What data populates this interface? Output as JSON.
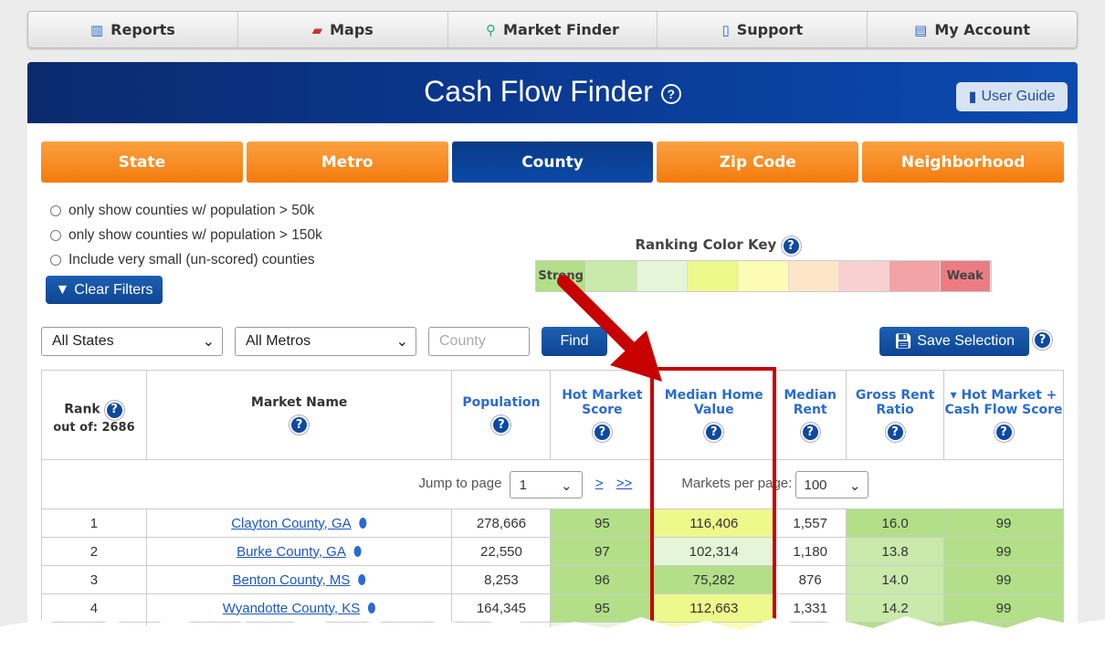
{
  "nav": [
    {
      "label": "Reports",
      "icon": "reports-icon"
    },
    {
      "label": "Maps",
      "icon": "map-icon"
    },
    {
      "label": "Market Finder",
      "icon": "market-finder-icon"
    },
    {
      "label": "Support",
      "icon": "phone-icon"
    },
    {
      "label": "My Account",
      "icon": "account-icon"
    }
  ],
  "banner": {
    "title": "Cash Flow Finder",
    "user_guide": "User Guide"
  },
  "tabs": [
    {
      "label": "State"
    },
    {
      "label": "Metro"
    },
    {
      "label": "County",
      "active": true
    },
    {
      "label": "Zip Code"
    },
    {
      "label": "Neighborhood"
    }
  ],
  "filters": [
    "only show counties w/ population > 50k",
    "only show counties w/ population > 150k",
    "Include very small (un-scored) counties"
  ],
  "clear_filters": "Clear Filters",
  "color_key": {
    "title": "Ranking Color Key",
    "strong": "Strong",
    "weak": "Weak",
    "colors": [
      "#b2df88",
      "#c9eaab",
      "#e5f5d8",
      "#eef98c",
      "#fbfbb3",
      "#fde6c8",
      "#f8d0d0",
      "#f2a3a6",
      "#ec7c82"
    ]
  },
  "controls": {
    "state": "All States",
    "metro": "All Metros",
    "county_placeholder": "County",
    "find": "Find",
    "save": "Save Selection"
  },
  "table": {
    "headers": {
      "rank": "Rank",
      "out_of": "out of: 2686",
      "market": "Market Name",
      "population": "Population",
      "hot": "Hot Market Score",
      "home": "Median Home Value",
      "rent": "Median Rent",
      "grr": "Gross Rent Ratio",
      "cash": "Hot Market + Cash Flow Score"
    },
    "pager": {
      "jump": "Jump to page",
      "page": "1",
      "next": ">",
      "last": ">>",
      "per_page_label": "Markets per page:",
      "per_page": "100"
    },
    "rows": [
      {
        "rank": "1",
        "name": "Clayton County, GA",
        "population": "278,666",
        "hot": "95",
        "home": "116,406",
        "rent": "1,557",
        "grr": "16.0",
        "cash": "99"
      },
      {
        "rank": "2",
        "name": "Burke County, GA",
        "population": "22,550",
        "hot": "97",
        "home": "102,314",
        "rent": "1,180",
        "grr": "13.8",
        "cash": "99"
      },
      {
        "rank": "3",
        "name": "Benton County, MS",
        "population": "8,253",
        "hot": "96",
        "home": "75,282",
        "rent": "876",
        "grr": "14.0",
        "cash": "99"
      },
      {
        "rank": "4",
        "name": "Wyandotte County, KS",
        "population": "164,345",
        "hot": "95",
        "home": "112,663",
        "rent": "1,331",
        "grr": "14.2",
        "cash": "99"
      }
    ]
  },
  "annotation": {
    "color": "#c70000"
  }
}
